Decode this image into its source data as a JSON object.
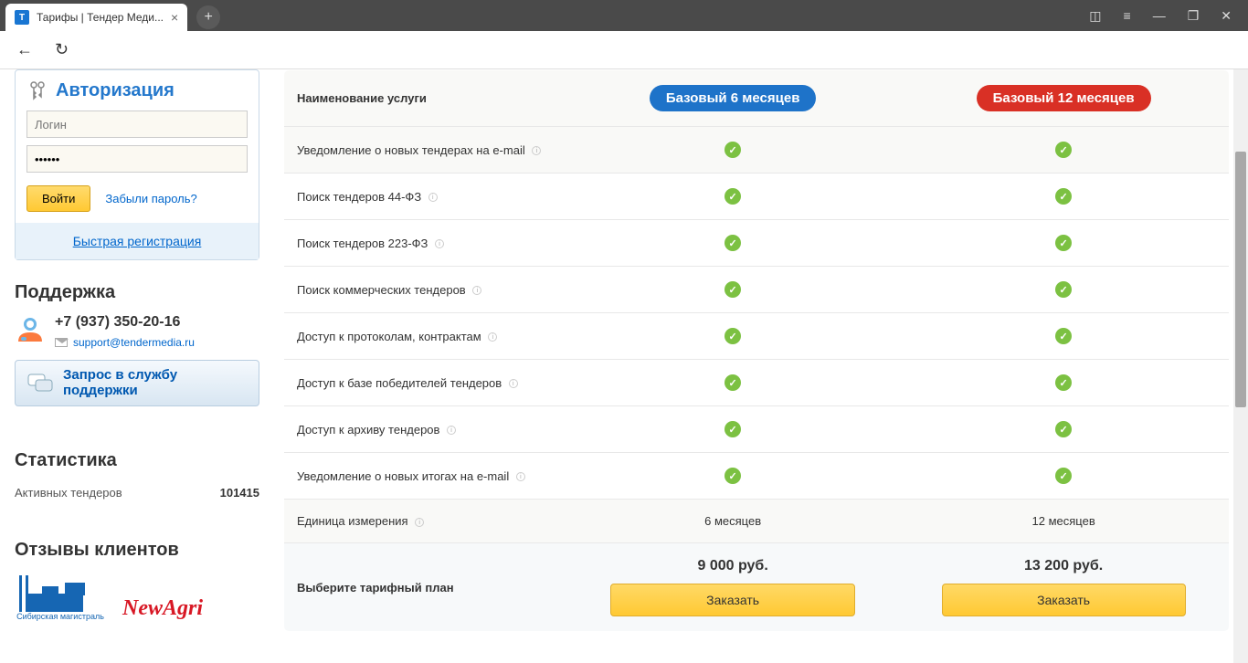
{
  "browser": {
    "tab_title": "Тарифы | Тендер Меди...",
    "favicon_letter": "Т"
  },
  "auth": {
    "title": "Авторизация",
    "login_placeholder": "Логин",
    "password_value": "••••••",
    "login_button": "Войти",
    "forgot": "Забыли пароль?",
    "quick_reg": "Быстрая регистрация"
  },
  "support": {
    "title": "Поддержка",
    "phone": "+7 (937) 350-20-16",
    "email": "support@tendermedia.ru",
    "request_line1": "Запрос в службу",
    "request_line2": "поддержки"
  },
  "stats": {
    "title": "Статистика",
    "label": "Активных тендеров",
    "value": "101415"
  },
  "reviews": {
    "title": "Отзывы клиентов",
    "logo1_label": "Сибирская магистраль",
    "logo2": "NewAgri"
  },
  "pricing": {
    "header_feature": "Наименование услуги",
    "plan1_name": "Базовый 6 месяцев",
    "plan2_name": "Базовый 12 месяцев",
    "features": [
      "Уведомление о новых тендерах на e-mail",
      "Поиск тендеров 44-ФЗ",
      "Поиск тендеров 223-ФЗ",
      "Поиск коммерческих тендеров",
      "Доступ к протоколам, контрактам",
      "Доступ к базе победителей тендеров",
      "Доступ к архиву тендеров",
      "Уведомление о новых итогах на e-mail"
    ],
    "unit_label": "Единица измерения",
    "unit1": "6 месяцев",
    "unit2": "12 месяцев",
    "select_label": "Выберите тарифный план",
    "price1": "9 000 руб.",
    "price2": "13 200 руб.",
    "order_btn": "Заказать"
  }
}
